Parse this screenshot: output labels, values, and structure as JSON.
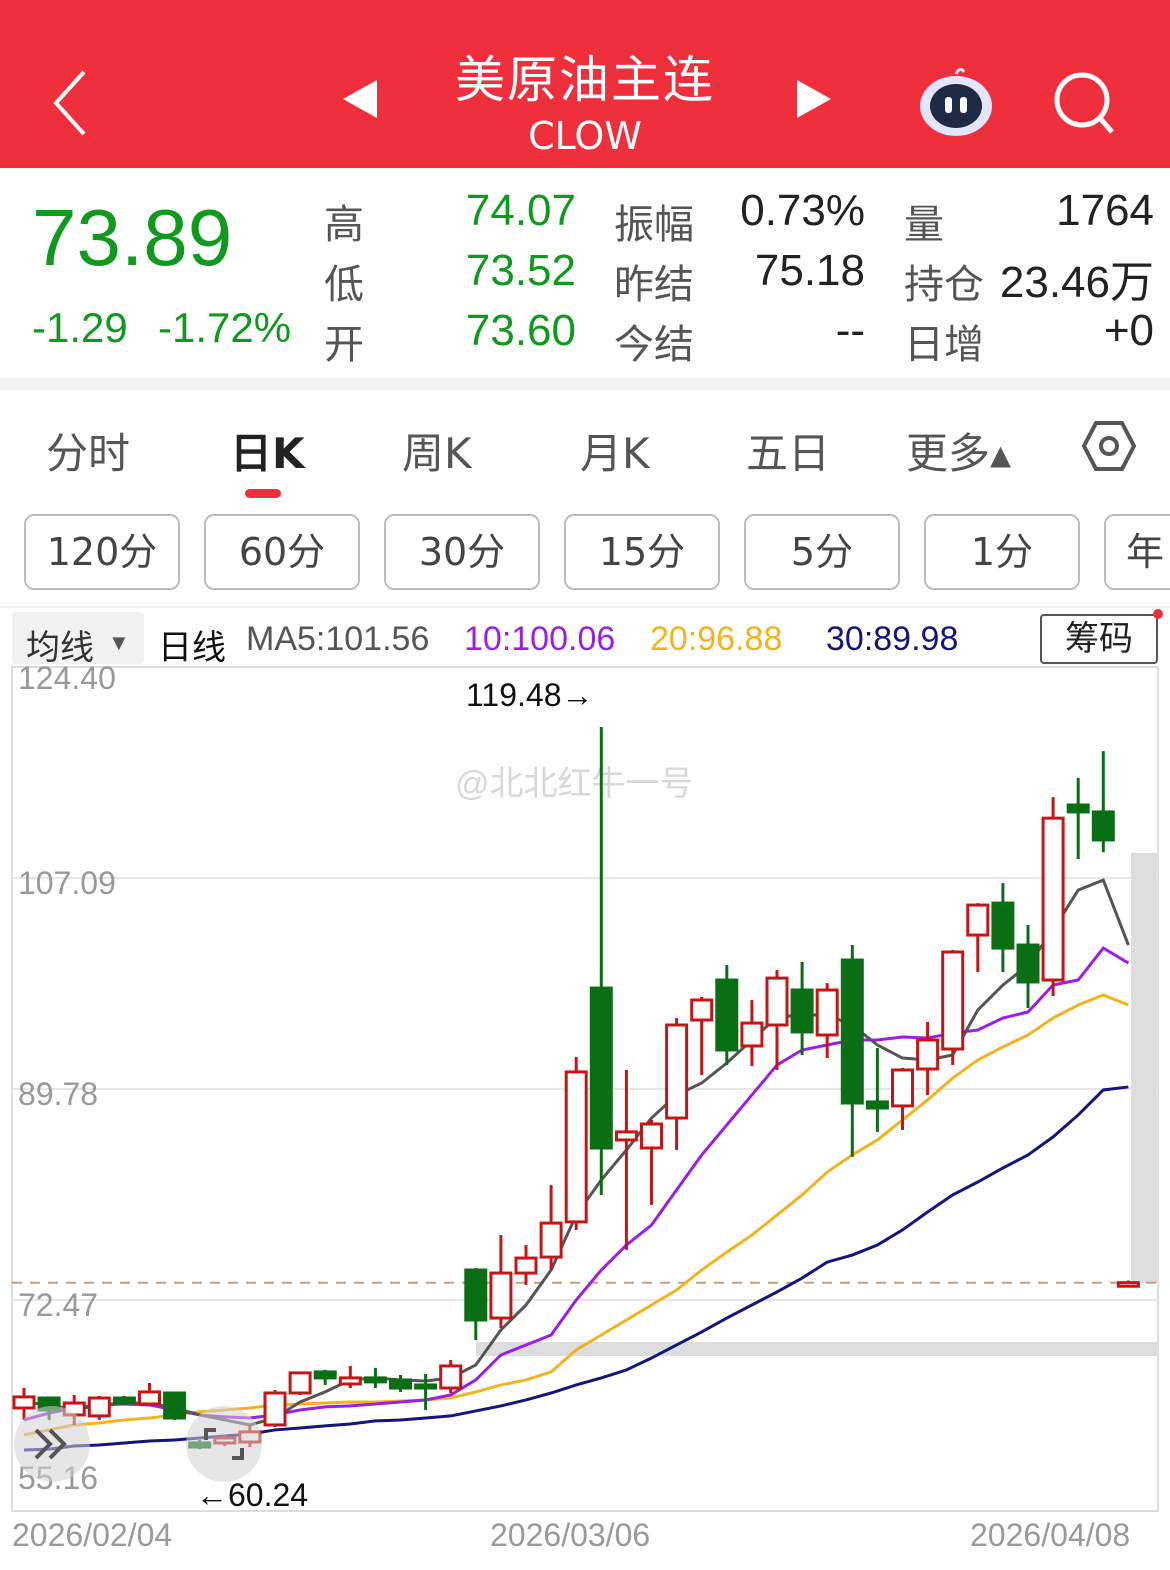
{
  "header": {
    "title": "美原油主连",
    "code": "CLOW"
  },
  "quote": {
    "price": "73.89",
    "change": "-1.29",
    "change_pct": "-1.72%",
    "rows": [
      {
        "l1": "高",
        "v1": "74.07",
        "l2": "振幅",
        "v2": "0.73%",
        "l3": "量",
        "v3": "1764"
      },
      {
        "l1": "低",
        "v1": "73.52",
        "l2": "昨结",
        "v2": "75.18",
        "l3": "持仓",
        "v3": "23.46万"
      },
      {
        "l1": "开",
        "v1": "73.60",
        "l2": "今结",
        "v2": "--",
        "l3": "日增",
        "v3": "+0"
      }
    ]
  },
  "tabs": [
    "分时",
    "日K",
    "周K",
    "月K",
    "五日",
    "更多▴"
  ],
  "active_tab": "日K",
  "periods": [
    "120分",
    "60分",
    "30分",
    "15分",
    "5分",
    "1分",
    "年"
  ],
  "ma_bar": {
    "selector": "均线",
    "type": "日线",
    "ma5": "MA5:101.56",
    "ma10": "10:100.06",
    "ma20": "20:96.88",
    "ma30": "30:89.98",
    "chips": "筹码"
  },
  "colors": {
    "up": "#c81414",
    "down": "#0a6e14",
    "ma5": "#555555",
    "ma10": "#9b1ee6",
    "ma20": "#f0b41e",
    "ma30": "#14147d",
    "brand": "#ef2f3b"
  },
  "watermark": "@北北红牛一号",
  "chart_data": {
    "type": "candlestick",
    "y_ticks": [
      "124.40",
      "107.09",
      "89.78",
      "72.47",
      "55.16"
    ],
    "ylim": [
      55.16,
      124.4
    ],
    "x_ticks": [
      "2026/02/04",
      "2026/03/06",
      "2026/04/08"
    ],
    "x_tick_index": [
      1,
      20,
      45
    ],
    "max_label": "119.48→",
    "min_label": "←60.24",
    "last_price": 73.89,
    "ohlc": [
      [
        63.61,
        65.25,
        62.63,
        64.52
      ],
      [
        64.43,
        64.43,
        62.63,
        63.45
      ],
      [
        63.04,
        64.68,
        62.22,
        64.02
      ],
      [
        62.96,
        64.6,
        62.63,
        64.43
      ],
      [
        64.43,
        64.6,
        63.86,
        64.02
      ],
      [
        63.94,
        65.66,
        63.86,
        64.93
      ],
      [
        64.84,
        64.84,
        62.63,
        62.79
      ],
      [
        60.74,
        60.98,
        60.24,
        60.41
      ],
      [
        60.74,
        61.39,
        60.49,
        61.15
      ],
      [
        60.82,
        62.22,
        60.41,
        61.65
      ],
      [
        62.22,
        65.09,
        62.06,
        64.84
      ],
      [
        64.84,
        66.57,
        64.68,
        66.49
      ],
      [
        66.57,
        66.74,
        65.5,
        66.08
      ],
      [
        65.58,
        67.06,
        65.25,
        66.08
      ],
      [
        66.08,
        66.9,
        65.25,
        65.75
      ],
      [
        65.91,
        66.32,
        64.93,
        65.25
      ],
      [
        65.5,
        66.4,
        63.45,
        65.25
      ],
      [
        65.25,
        67.55,
        64.84,
        67.06
      ],
      [
        74.93,
        75.09,
        69.19,
        70.83
      ],
      [
        70.99,
        77.8,
        70.17,
        74.68
      ],
      [
        74.68,
        76.98,
        73.71,
        75.91
      ],
      [
        75.99,
        81.9,
        74.93,
        78.78
      ],
      [
        78.88,
        92.41,
        78.22,
        91.18
      ],
      [
        98.06,
        119.48,
        81.09,
        84.94
      ],
      [
        85.6,
        91.34,
        76.58,
        86.26
      ],
      [
        84.94,
        87.24,
        80.27,
        86.91
      ],
      [
        87.4,
        95.6,
        84.78,
        95.03
      ],
      [
        95.44,
        97.33,
        90.93,
        97.08
      ],
      [
        98.72,
        99.95,
        91.75,
        92.98
      ],
      [
        93.31,
        97.08,
        91.67,
        95.19
      ],
      [
        95.03,
        99.54,
        91.34,
        98.88
      ],
      [
        97.9,
        100.2,
        92.57,
        94.46
      ],
      [
        94.21,
        98.47,
        92.32,
        97.9
      ],
      [
        100.36,
        101.59,
        84.21,
        88.63
      ],
      [
        88.72,
        93.14,
        86.26,
        88.22
      ],
      [
        88.39,
        91.51,
        86.42,
        91.34
      ],
      [
        91.42,
        95.28,
        89.29,
        93.8
      ],
      [
        93.06,
        101.18,
        91.75,
        101.02
      ],
      [
        102.41,
        105.03,
        99.38,
        104.87
      ],
      [
        105.03,
        106.67,
        99.38,
        101.34
      ],
      [
        101.59,
        103.23,
        96.42,
        98.56
      ],
      [
        98.72,
        113.72,
        97.41,
        112.0
      ],
      [
        113.08,
        115.3,
        108.65,
        112.51
      ],
      [
        112.51,
        117.5,
        109.2,
        110.21
      ],
      [
        73.6,
        74.07,
        73.52,
        73.89
      ]
    ],
    "ma5": [
      64.1,
      63.86,
      63.45,
      63.86,
      64.02,
      64.02,
      63.61,
      63.04,
      62.63,
      62.22,
      62.79,
      64.1,
      64.93,
      65.91,
      66.08,
      65.91,
      65.83,
      66.08,
      67.14,
      70.01,
      72.06,
      74.93,
      79.44,
      82.32,
      84.78,
      87.4,
      89.29,
      90.27,
      91.91,
      93.8,
      95.69,
      95.85,
      95.85,
      95.03,
      93.39,
      92.32,
      92.16,
      92.57,
      96.26,
      98.31,
      99.95,
      102.82,
      106.1,
      106.92,
      101.59
    ],
    "ma10": [
      62.63,
      63.2,
      63.61,
      63.86,
      63.94,
      63.86,
      63.45,
      63.04,
      62.88,
      62.79,
      63.04,
      63.45,
      63.7,
      63.78,
      63.94,
      64.1,
      64.27,
      64.68,
      65.91,
      67.96,
      68.78,
      69.6,
      72.47,
      74.93,
      76.98,
      78.62,
      81.5,
      84.37,
      86.83,
      89.29,
      91.75,
      92.98,
      93.39,
      93.8,
      93.8,
      94.05,
      93.96,
      94.37,
      94.62,
      95.6,
      96.1,
      98.31,
      98.72,
      101.34,
      100.11
    ],
    "ma20": [
      61.4,
      61.81,
      62.22,
      62.38,
      62.63,
      62.79,
      63.04,
      63.29,
      63.45,
      63.61,
      63.86,
      63.94,
      64.02,
      64.1,
      64.1,
      64.18,
      64.27,
      64.43,
      64.93,
      65.5,
      65.91,
      66.57,
      68.37,
      69.6,
      70.83,
      72.06,
      73.29,
      74.93,
      76.4,
      77.8,
      79.44,
      81.09,
      82.97,
      84.37,
      85.6,
      87.24,
      88.88,
      90.68,
      92.16,
      93.23,
      94.21,
      95.6,
      96.67,
      97.49,
      96.67
    ],
    "ma30": [
      60.16,
      60.24,
      60.49,
      60.57,
      60.74,
      60.9,
      60.98,
      61.15,
      61.31,
      61.48,
      61.81,
      61.97,
      62.14,
      62.3,
      62.55,
      62.63,
      62.79,
      62.96,
      63.37,
      63.78,
      64.27,
      64.84,
      65.5,
      66.08,
      66.73,
      67.71,
      68.78,
      69.85,
      70.99,
      72.06,
      73.13,
      74.27,
      75.58,
      76.16,
      76.98,
      78.22,
      79.69,
      81.09,
      82.15,
      83.3,
      84.37,
      85.85,
      87.65,
      89.7,
      89.95
    ]
  }
}
